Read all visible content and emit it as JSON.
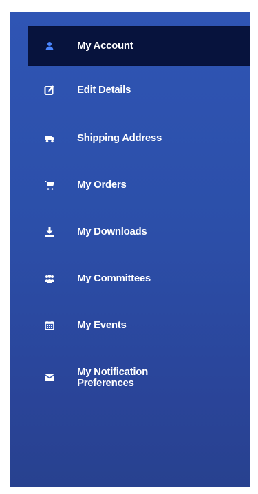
{
  "sidebar": {
    "items": [
      {
        "label": "My Account",
        "icon": "user-icon",
        "active": true
      },
      {
        "label": "Edit Details",
        "icon": "edit-icon",
        "active": false
      },
      {
        "label": "Shipping Address",
        "icon": "truck-icon",
        "active": false
      },
      {
        "label": "My Orders",
        "icon": "cart-icon",
        "active": false
      },
      {
        "label": "My Downloads",
        "icon": "download-icon",
        "active": false
      },
      {
        "label": "My Committees",
        "icon": "group-icon",
        "active": false
      },
      {
        "label": "My Events",
        "icon": "calendar-icon",
        "active": false
      },
      {
        "label": "My Notification Preferences",
        "icon": "envelope-icon",
        "active": false
      }
    ]
  },
  "colors": {
    "panel": "#2c4fa9",
    "active": "#07133d",
    "text": "#ffffff"
  }
}
